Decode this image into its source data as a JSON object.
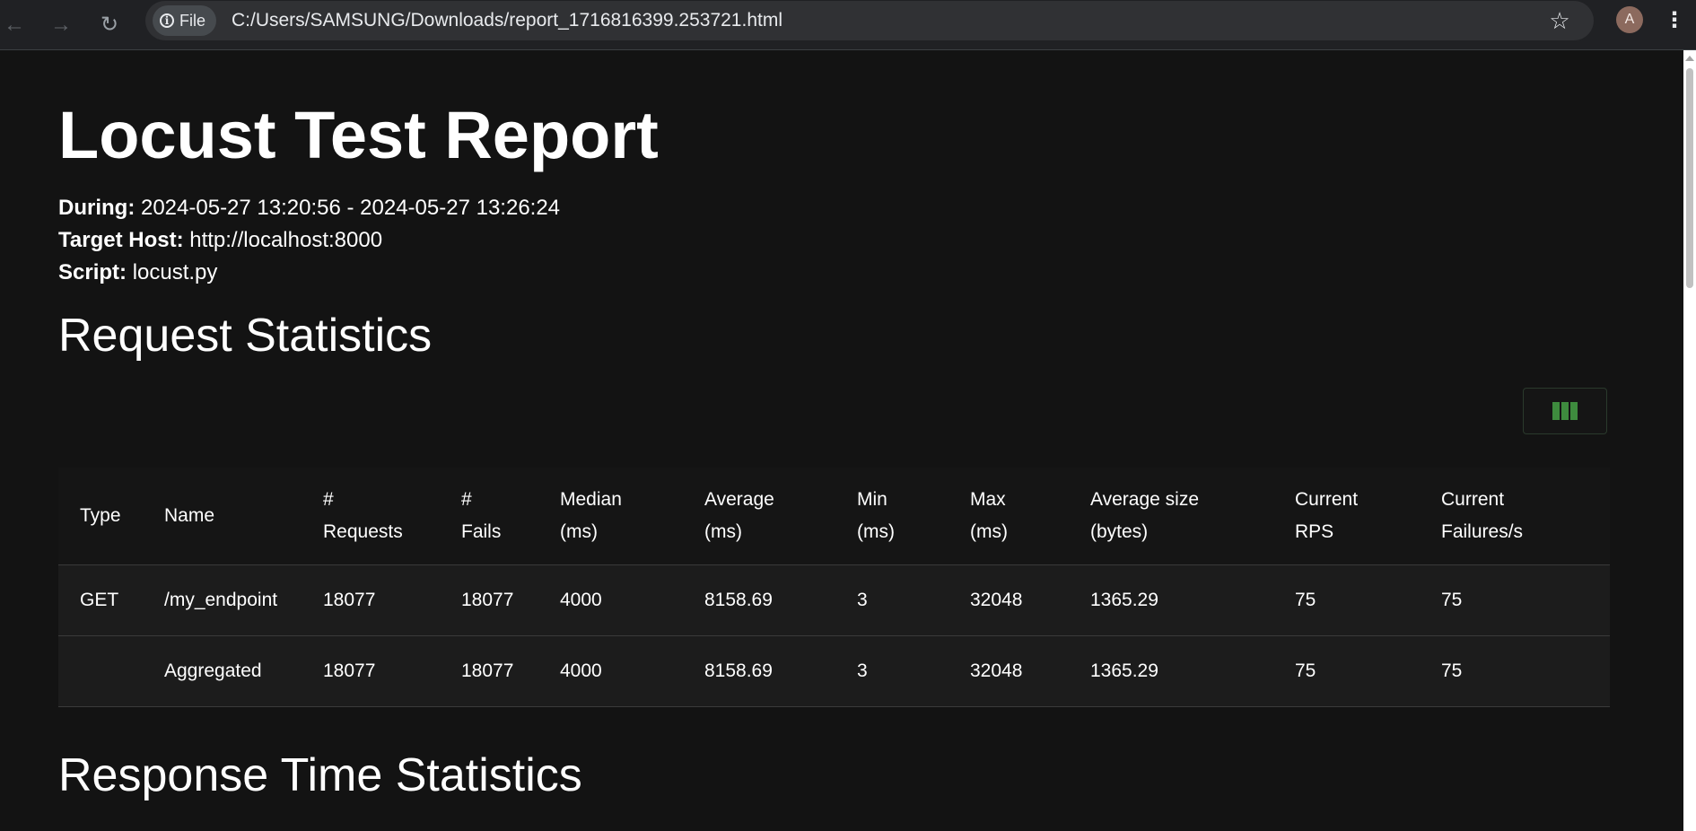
{
  "browser": {
    "site_chip_label": "File",
    "url": "C:/Users/SAMSUNG/Downloads/report_1716816399.253721.html",
    "avatar_letter": "A"
  },
  "report": {
    "title": "Locust Test Report",
    "during_label": "During:",
    "during_value": "2024-05-27 13:20:56 - 2024-05-27 13:26:24",
    "host_label": "Target Host:",
    "host_value": "http://localhost:8000",
    "script_label": "Script:",
    "script_value": "locust.py"
  },
  "request_stats": {
    "heading": "Request Statistics",
    "columns": [
      [
        "Type"
      ],
      [
        "Name"
      ],
      [
        "#",
        "Requests"
      ],
      [
        "#",
        "Fails"
      ],
      [
        "Median",
        "(ms)"
      ],
      [
        "Average",
        "(ms)"
      ],
      [
        "Min",
        "(ms)"
      ],
      [
        "Max",
        "(ms)"
      ],
      [
        "Average size",
        "(bytes)"
      ],
      [
        "Current",
        "RPS"
      ],
      [
        "Current",
        "Failures/s"
      ]
    ],
    "rows": [
      [
        "GET",
        "/my_endpoint",
        "18077",
        "18077",
        "4000",
        "8158.69",
        "3",
        "32048",
        "1365.29",
        "75",
        "75"
      ],
      [
        "",
        "Aggregated",
        "18077",
        "18077",
        "4000",
        "8158.69",
        "3",
        "32048",
        "1365.29",
        "75",
        "75"
      ]
    ]
  },
  "response_stats": {
    "heading": "Response Time Statistics"
  },
  "colors": {
    "page_background": "#131313",
    "toggle_icon": "#3e8b3e"
  }
}
